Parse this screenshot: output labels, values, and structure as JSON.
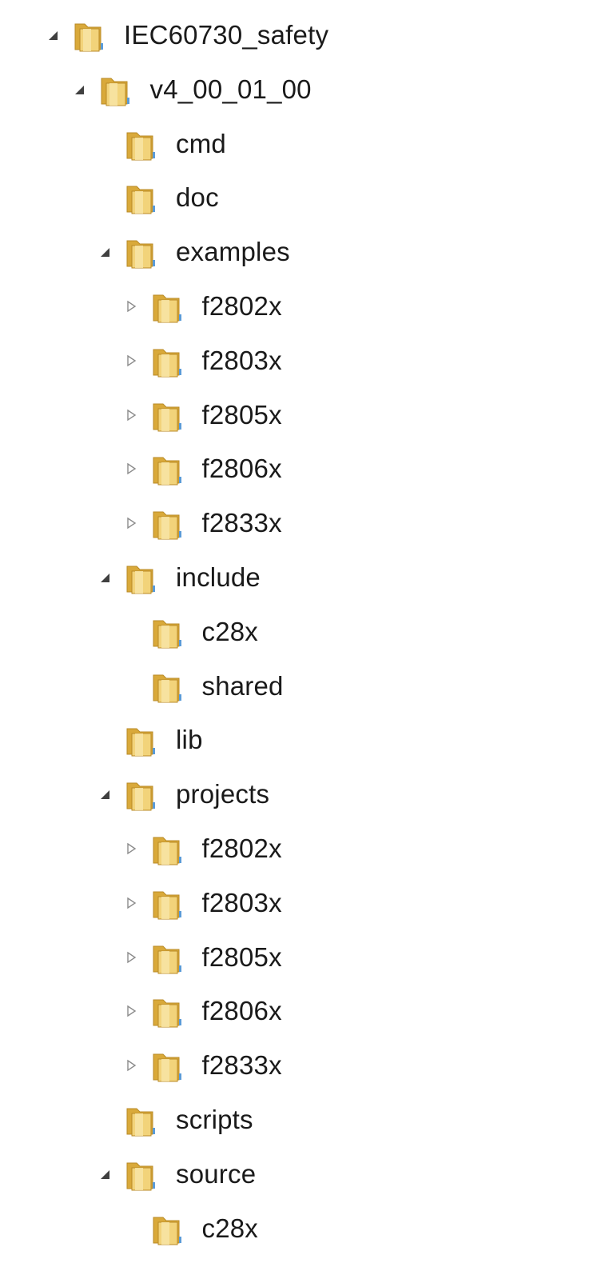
{
  "tree": {
    "rows": [
      {
        "label": "IEC60730_safety",
        "depth": 0,
        "state": "expanded"
      },
      {
        "label": "v4_00_01_00",
        "depth": 1,
        "state": "expanded"
      },
      {
        "label": "cmd",
        "depth": 2,
        "state": "leaf"
      },
      {
        "label": "doc",
        "depth": 2,
        "state": "leaf"
      },
      {
        "label": "examples",
        "depth": 2,
        "state": "expanded"
      },
      {
        "label": "f2802x",
        "depth": 3,
        "state": "collapsed"
      },
      {
        "label": "f2803x",
        "depth": 3,
        "state": "collapsed"
      },
      {
        "label": "f2805x",
        "depth": 3,
        "state": "collapsed"
      },
      {
        "label": "f2806x",
        "depth": 3,
        "state": "collapsed"
      },
      {
        "label": "f2833x",
        "depth": 3,
        "state": "collapsed"
      },
      {
        "label": "include",
        "depth": 2,
        "state": "expanded"
      },
      {
        "label": "c28x",
        "depth": 3,
        "state": "leaf"
      },
      {
        "label": "shared",
        "depth": 3,
        "state": "leaf"
      },
      {
        "label": "lib",
        "depth": 2,
        "state": "leaf"
      },
      {
        "label": "projects",
        "depth": 2,
        "state": "expanded"
      },
      {
        "label": "f2802x",
        "depth": 3,
        "state": "collapsed"
      },
      {
        "label": "f2803x",
        "depth": 3,
        "state": "collapsed"
      },
      {
        "label": "f2805x",
        "depth": 3,
        "state": "collapsed"
      },
      {
        "label": "f2806x",
        "depth": 3,
        "state": "collapsed"
      },
      {
        "label": "f2833x",
        "depth": 3,
        "state": "collapsed"
      },
      {
        "label": "scripts",
        "depth": 2,
        "state": "leaf"
      },
      {
        "label": "source",
        "depth": 2,
        "state": "expanded"
      },
      {
        "label": "c28x",
        "depth": 3,
        "state": "leaf"
      }
    ]
  },
  "icons": {
    "folder": "folder-icon",
    "expanded": "expanded-triangle-icon",
    "collapsed": "collapsed-triangle-icon"
  },
  "colors": {
    "folder_front": "#f2d37a",
    "folder_back": "#d9a93a",
    "folder_edge": "#b98a25",
    "arrow_expanded": "#404040",
    "arrow_collapsed": "#8c8c8c"
  }
}
